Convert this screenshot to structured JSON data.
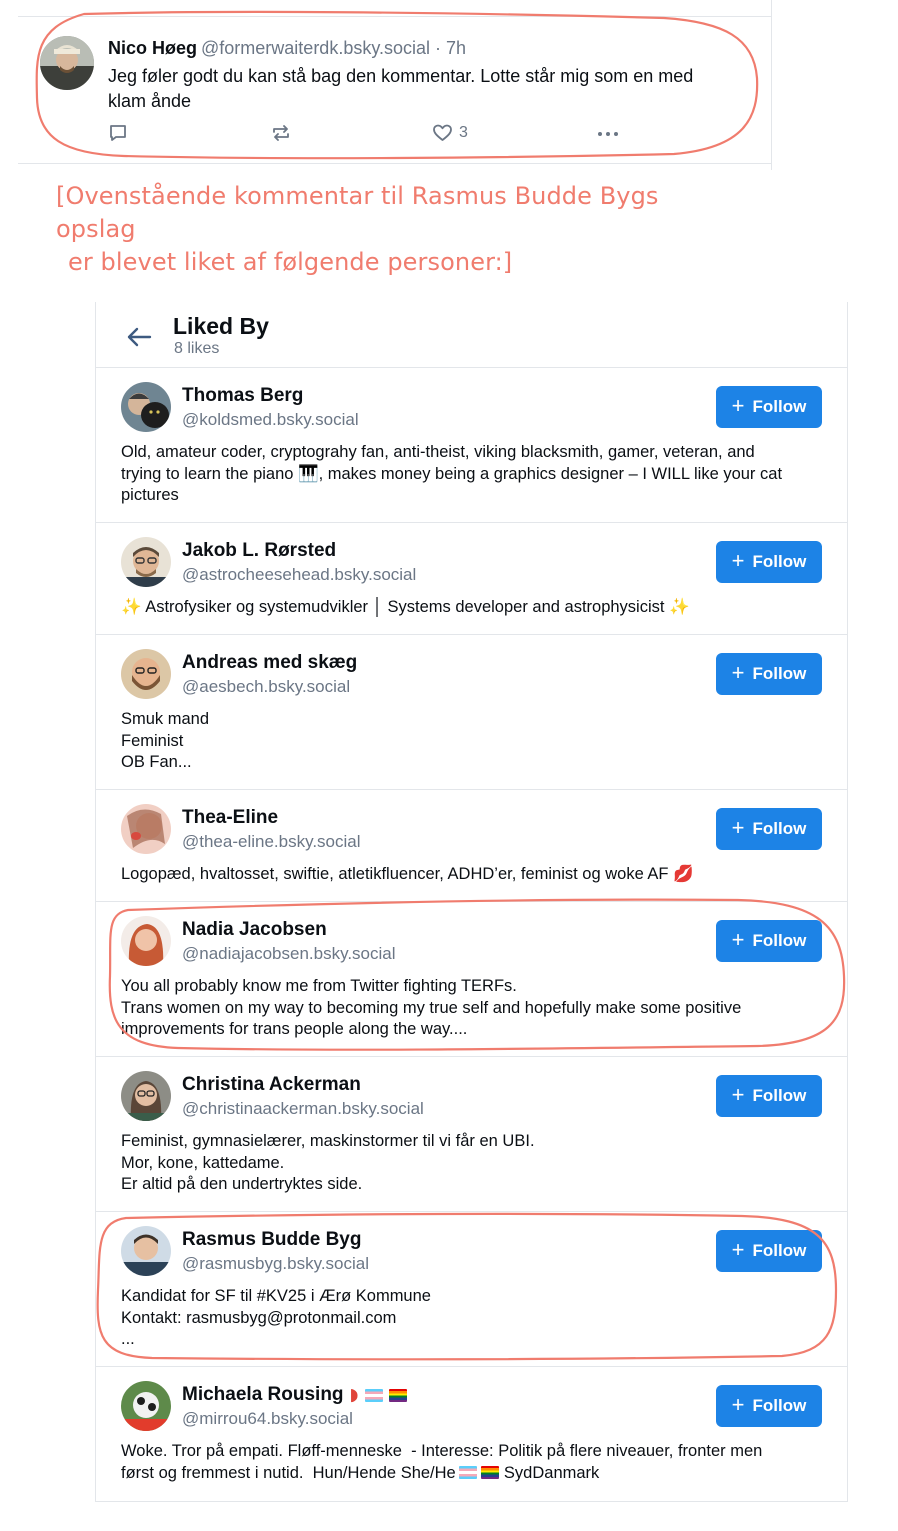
{
  "post": {
    "author": "Nico Høeg",
    "handle": "@formerwaiterdk.bsky.social · 7h",
    "text": "Jeg føler godt du kan stå bag den kommentar. Lotte står mig som en med klam ånde",
    "like_count": "3"
  },
  "annotation": {
    "line1": "[Ovenstående kommentar til Rasmus Budde Bygs opslag",
    "line2": "er blevet liket af følgende personer:]"
  },
  "liked_by": {
    "title": "Liked By",
    "subtitle": "8 likes",
    "follow_label": "Follow",
    "users": [
      {
        "name": "Thomas Berg",
        "handle": "@koldsmed.bsky.social",
        "bio": [
          "Old, amateur coder, cryptograhy fan, anti-theist, viking blacksmith, gamer, veteran, and",
          "trying to learn the piano 🎹, makes money being a graphics designer – I WILL like your cat",
          "pictures"
        ]
      },
      {
        "name": "Jakob L. Rørsted",
        "handle": "@astrocheesehead.bsky.social",
        "bio": [
          "✨ Astrofysiker og systemudvikler │ Systems developer and astrophysicist ✨"
        ]
      },
      {
        "name": "Andreas med skæg",
        "handle": "@aesbech.bsky.social",
        "bio": [
          "Smuk mand",
          "Feminist",
          "OB Fan..."
        ]
      },
      {
        "name": "Thea-Eline",
        "handle": "@thea-eline.bsky.social",
        "bio": [
          "Logopæd, hvaltosset, swiftie, atletikfluencer, ADHD’er, feminist og woke AF 💋"
        ]
      },
      {
        "name": "Nadia Jacobsen",
        "handle": "@nadiajacobsen.bsky.social",
        "bio": [
          "You all probably know me from Twitter fighting TERFs.",
          "Trans women on my way to becoming my true self and hopefully make some positive",
          "improvements for trans people along the way...."
        ]
      },
      {
        "name": "Christina Ackerman",
        "handle": "@christinaackerman.bsky.social",
        "bio": [
          "Feminist, gymnasielærer, maskinstormer til vi får en UBI.",
          "Mor, kone, kattedame.",
          "Er altid på den undertryktes side."
        ]
      },
      {
        "name": "Rasmus Budde Byg",
        "handle": "@rasmusbyg.bsky.social",
        "bio": [
          "Kandidat for SF til #KV25 i Ærø Kommune",
          "Kontakt: rasmusbyg@protonmail.com",
          "..."
        ]
      },
      {
        "name": "Michaela Rousing",
        "handle": "@mirrou64.bsky.social",
        "bio": [
          "Woke. Tror på empati. Fløff-menneske  - Interesse: Politik på flere niveauer, fronter men",
          "først og fremmest i nutid.  Hun/Hende She/He",
          "SydDanmark"
        ]
      }
    ]
  },
  "colors": {
    "accent": "#1d83e6",
    "annotation": "#f07c6e",
    "muted": "#6b7685"
  }
}
